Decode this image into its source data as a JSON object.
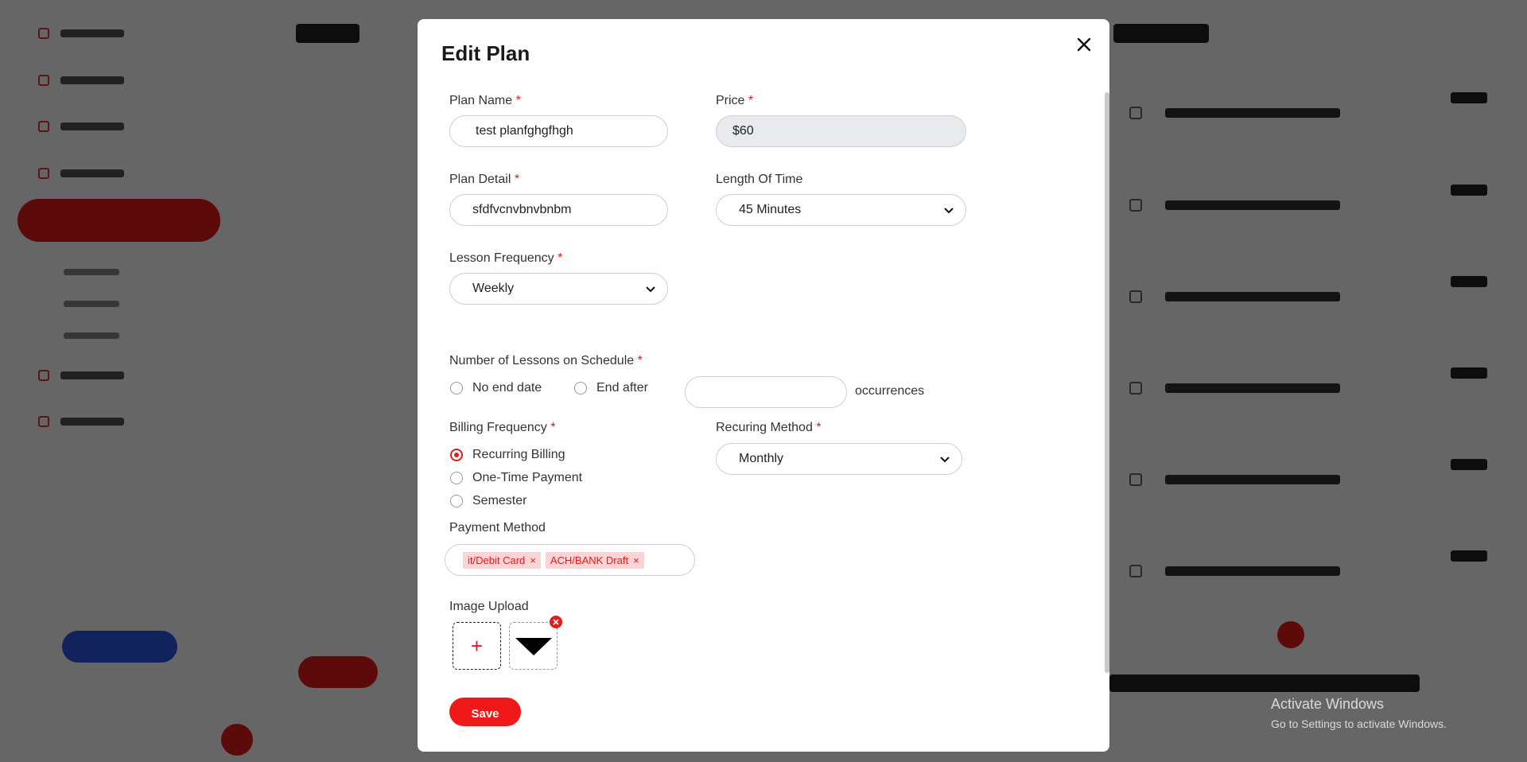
{
  "modal": {
    "title": "Edit Plan",
    "plan_name": {
      "label": "Plan Name",
      "required": "*",
      "value": "test planfghgfhgh"
    },
    "price": {
      "label": "Price",
      "required": "*",
      "value": "$60"
    },
    "plan_detail": {
      "label": "Plan Detail",
      "required": "*",
      "value": "sfdfvcnvbnvbnbm"
    },
    "length_of_time": {
      "label": "Length Of Time",
      "value": "45 Minutes"
    },
    "lesson_frequency": {
      "label": "Lesson Frequency",
      "required": "*",
      "value": "Weekly"
    },
    "lessons_on_schedule": {
      "label": "Number of Lessons on Schedule",
      "required": "*",
      "no_end_date": "No end date",
      "end_after": "End after",
      "occurrences_value": "",
      "occurrences_label": "occurrences"
    },
    "billing_frequency": {
      "label": "Billing Frequency",
      "required": "*",
      "options": [
        "Recurring Billing",
        "One-Time Payment",
        "Semester"
      ],
      "selected": "Recurring Billing"
    },
    "recurring_method": {
      "label": "Recuring Method",
      "required": "*",
      "value": "Monthly"
    },
    "payment_method": {
      "label": "Payment Method",
      "tags": [
        "it/Debit Card",
        "ACH/BANK Draft"
      ],
      "remove_glyph": "×"
    },
    "image_upload": {
      "label": "Image Upload",
      "add_glyph": "+"
    },
    "save_label": "Save"
  },
  "watermark": {
    "line1": "Activate Windows",
    "line2": "Go to Settings to activate Windows."
  },
  "colors": {
    "accent": "#e51b1b",
    "overlay": "rgba(0,0,0,0.6)"
  },
  "icons": {
    "close": "close-icon",
    "chevron": "chevron-down-icon",
    "remove": "remove-icon",
    "image": "triangle-image-icon"
  }
}
